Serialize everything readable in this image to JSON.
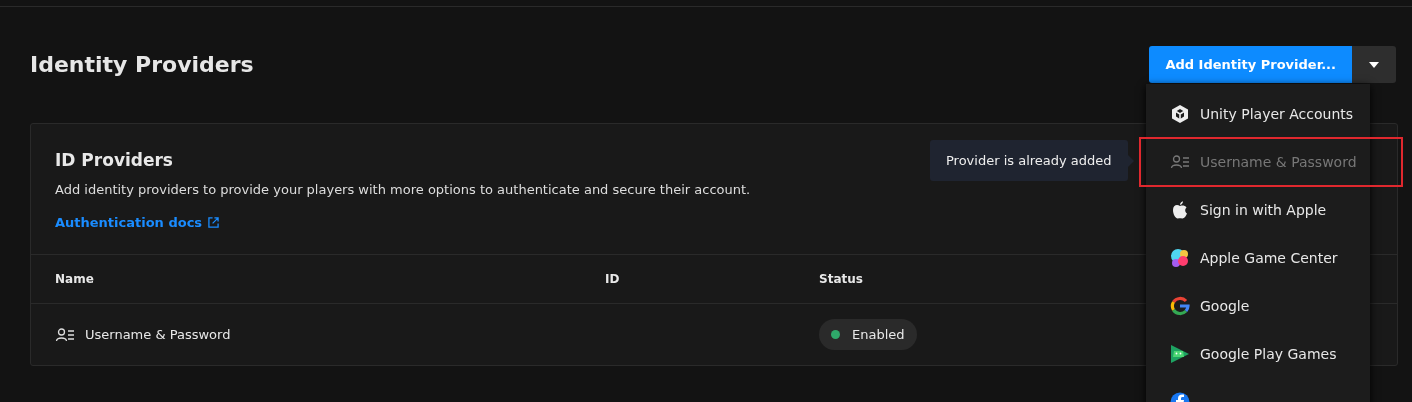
{
  "page": {
    "title": "Identity Providers"
  },
  "add_button": {
    "label": "Add Identity Provider..."
  },
  "menu": {
    "items": [
      {
        "kind": "unity",
        "label": "Unity Player Accounts",
        "disabled": false,
        "highlighted": false
      },
      {
        "kind": "user",
        "label": "Username & Password",
        "disabled": true,
        "highlighted": true
      },
      {
        "kind": "apple",
        "label": "Sign in with Apple",
        "disabled": false,
        "highlighted": false
      },
      {
        "kind": "gamecenter",
        "label": "Apple Game Center",
        "disabled": false,
        "highlighted": false
      },
      {
        "kind": "google",
        "label": "Google",
        "disabled": false,
        "highlighted": false
      },
      {
        "kind": "playgames",
        "label": "Google Play Games",
        "disabled": false,
        "highlighted": false
      },
      {
        "kind": "facebook"
      }
    ]
  },
  "tooltip": {
    "text": "Provider is already added"
  },
  "card": {
    "title": "ID Providers",
    "description": "Add identity providers to provide your players with more options to authenticate and secure their account.",
    "link": "Authentication docs"
  },
  "table": {
    "columns": [
      "Name",
      "ID",
      "Status"
    ],
    "rows": [
      {
        "kind": "user",
        "name": "Username & Password",
        "status": "Enabled",
        "enabled": true
      }
    ]
  }
}
